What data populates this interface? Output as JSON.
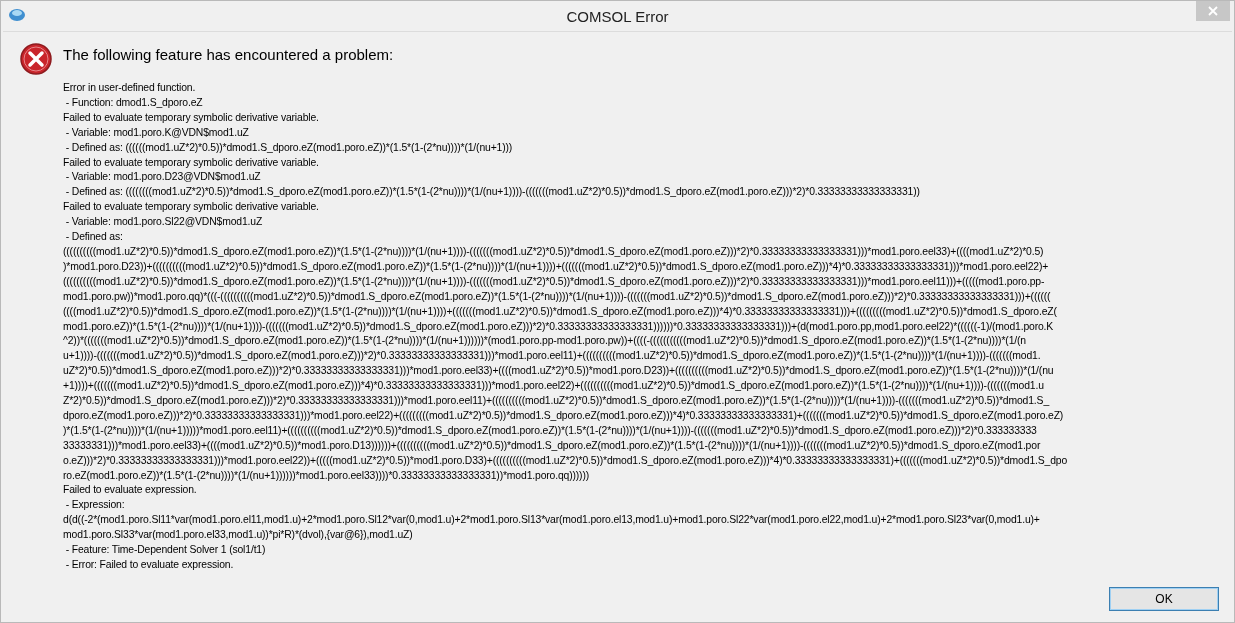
{
  "window": {
    "title": "COMSOL Error"
  },
  "heading": "The following feature has encountered a problem:",
  "message_lines": [
    "Error in user-defined function.",
    " - Function: dmod1.S_dporo.eZ",
    "Failed to evaluate temporary symbolic derivative variable.",
    " - Variable: mod1.poro.K@VDN$mod1.uZ",
    " - Defined as: ((((((mod1.uZ*2)*0.5))*dmod1.S_dporo.eZ(mod1.poro.eZ))*(1.5*(1-(2*nu))))*(1/(nu+1)))",
    "Failed to evaluate temporary symbolic derivative variable.",
    " - Variable: mod1.poro.D23@VDN$mod1.uZ",
    " - Defined as: ((((((((mod1.uZ*2)*0.5))*dmod1.S_dporo.eZ(mod1.poro.eZ))*(1.5*(1-(2*nu))))*(1/(nu+1))))-(((((((mod1.uZ*2)*0.5))*dmod1.S_dporo.eZ(mod1.poro.eZ)))*2)*0.33333333333333331))",
    "Failed to evaluate temporary symbolic derivative variable.",
    " - Variable: mod1.poro.Sl22@VDN$mod1.uZ",
    " - Defined as:",
    "((((((((((mod1.uZ*2)*0.5))*dmod1.S_dporo.eZ(mod1.poro.eZ))*(1.5*(1-(2*nu))))*(1/(nu+1))))-(((((((mod1.uZ*2)*0.5))*dmod1.S_dporo.eZ(mod1.poro.eZ)))*2)*0.33333333333333331)))*mod1.poro.eel33)+((((mod1.uZ*2)*0.5)",
    ")*mod1.poro.D23))+((((((((((mod1.uZ*2)*0.5))*dmod1.S_dporo.eZ(mod1.poro.eZ))*(1.5*(1-(2*nu))))*(1/(nu+1))))+(((((((mod1.uZ*2)*0.5))*dmod1.S_dporo.eZ(mod1.poro.eZ)))*4)*0.33333333333333331)))*mod1.poro.eel22)+",
    "((((((((((mod1.uZ*2)*0.5))*dmod1.S_dporo.eZ(mod1.poro.eZ))*(1.5*(1-(2*nu))))*(1/(nu+1))))-(((((((mod1.uZ*2)*0.5))*dmod1.S_dporo.eZ(mod1.poro.eZ)))*2)*0.33333333333333331)))*mod1.poro.eel11)))+(((((mod1.poro.pp-",
    "mod1.poro.pw))*mod1.poro.qq)*(((-((((((((((mod1.uZ*2)*0.5))*dmod1.S_dporo.eZ(mod1.poro.eZ))*(1.5*(1-(2*nu))))*(1/(nu+1))))-(((((((mod1.uZ*2)*0.5))*dmod1.S_dporo.eZ(mod1.poro.eZ)))*2)*0.33333333333333331)))+((((((",
    "((((mod1.uZ*2)*0.5))*dmod1.S_dporo.eZ(mod1.poro.eZ))*(1.5*(1-(2*nu))))*(1/(nu+1))))+(((((((mod1.uZ*2)*0.5))*dmod1.S_dporo.eZ(mod1.poro.eZ)))*4)*0.33333333333333331)))+(((((((((mod1.uZ*2)*0.5))*dmod1.S_dporo.eZ(",
    "mod1.poro.eZ))*(1.5*(1-(2*nu))))*(1/(nu+1))))-(((((((mod1.uZ*2)*0.5))*dmod1.S_dporo.eZ(mod1.poro.eZ)))*2)*0.33333333333333331))))))*0.33333333333333331)))+(d(mod1.poro.pp,mod1.poro.eel22)*((((((-1)/(mod1.poro.K",
    "^2))*(((((((mod1.uZ*2)*0.5))*dmod1.S_dporo.eZ(mod1.poro.eZ))*(1.5*(1-(2*nu))))*(1/(nu+1))))))*(mod1.poro.pp-mod1.poro.pw))+((((-(((((((((((mod1.uZ*2)*0.5))*dmod1.S_dporo.eZ(mod1.poro.eZ))*(1.5*(1-(2*nu))))*(1/(n",
    "u+1))))-(((((((mod1.uZ*2)*0.5))*dmod1.S_dporo.eZ(mod1.poro.eZ)))*2)*0.33333333333333331)))*mod1.poro.eel11)+((((((((((mod1.uZ*2)*0.5))*dmod1.S_dporo.eZ(mod1.poro.eZ))*(1.5*(1-(2*nu))))*(1/(nu+1))))-(((((((mod1.",
    "uZ*2)*0.5))*dmod1.S_dporo.eZ(mod1.poro.eZ)))*2)*0.33333333333333331)))*mod1.poro.eel33)+((((mod1.uZ*2)*0.5))*mod1.poro.D23))+((((((((((mod1.uZ*2)*0.5))*dmod1.S_dporo.eZ(mod1.poro.eZ))*(1.5*(1-(2*nu))))*(1/(nu",
    "+1))))+(((((((mod1.uZ*2)*0.5))*dmod1.S_dporo.eZ(mod1.poro.eZ)))*4)*0.33333333333333331)))*mod1.poro.eel22)+((((((((((mod1.uZ*2)*0.5))*dmod1.S_dporo.eZ(mod1.poro.eZ))*(1.5*(1-(2*nu))))*(1/(nu+1))))-(((((((mod1.u",
    "Z*2)*0.5))*dmod1.S_dporo.eZ(mod1.poro.eZ)))*2)*0.33333333333333331)))*mod1.poro.eel11)+((((((((((mod1.uZ*2)*0.5))*dmod1.S_dporo.eZ(mod1.poro.eZ))*(1.5*(1-(2*nu))))*(1/(nu+1))))-(((((((mod1.uZ*2)*0.5))*dmod1.S_",
    "dporo.eZ(mod1.poro.eZ)))*2)*0.33333333333333331)))*mod1.poro.eel22)+(((((((((mod1.uZ*2)*0.5))*dmod1.S_dporo.eZ(mod1.poro.eZ)))*4)*0.33333333333333331)+(((((((mod1.uZ*2)*0.5))*dmod1.S_dporo.eZ(mod1.poro.eZ)",
    ")*(1.5*(1-(2*nu))))*(1/(nu+1)))))*mod1.poro.eel11)+((((((((((mod1.uZ*2)*0.5))*dmod1.S_dporo.eZ(mod1.poro.eZ))*(1.5*(1-(2*nu))))*(1/(nu+1))))-(((((((mod1.uZ*2)*0.5))*dmod1.S_dporo.eZ(mod1.poro.eZ)))*2)*0.333333333",
    "33333331)))*mod1.poro.eel33)+((((mod1.uZ*2)*0.5))*mod1.poro.D13))))))+((((((((((mod1.uZ*2)*0.5))*dmod1.S_dporo.eZ(mod1.poro.eZ))*(1.5*(1-(2*nu))))*(1/(nu+1))))-(((((((mod1.uZ*2)*0.5))*dmod1.S_dporo.eZ(mod1.por",
    "o.eZ)))*2)*0.33333333333333331)))*mod1.poro.eel22))+(((((mod1.uZ*2)*0.5))*mod1.poro.D33)+((((((((((mod1.uZ*2)*0.5))*dmod1.S_dporo.eZ(mod1.poro.eZ)))*4)*0.33333333333333331)+(((((((mod1.uZ*2)*0.5))*dmod1.S_dpo",
    "ro.eZ(mod1.poro.eZ))*(1.5*(1-(2*nu))))*(1/(nu+1))))))*mod1.poro.eel33))))*0.33333333333333331))*mod1.poro.qq))))))",
    "Failed to evaluate expression.",
    " - Expression:",
    "d(d((-2*(mod1.poro.Sl11*var(mod1.poro.el11,mod1.u)+2*mod1.poro.Sl12*var(0,mod1.u)+2*mod1.poro.Sl13*var(mod1.poro.el13,mod1.u)+mod1.poro.Sl22*var(mod1.poro.el22,mod1.u)+2*mod1.poro.Sl23*var(0,mod1.u)+",
    "mod1.poro.Sl33*var(mod1.poro.el33,mod1.u))*pi*R)*(dvol),{var@6}),mod1.uZ)",
    " - Feature: Time-Dependent Solver 1 (sol1/t1)",
    " - Error: Failed to evaluate expression."
  ],
  "buttons": [
    {
      "label": "OK"
    }
  ]
}
